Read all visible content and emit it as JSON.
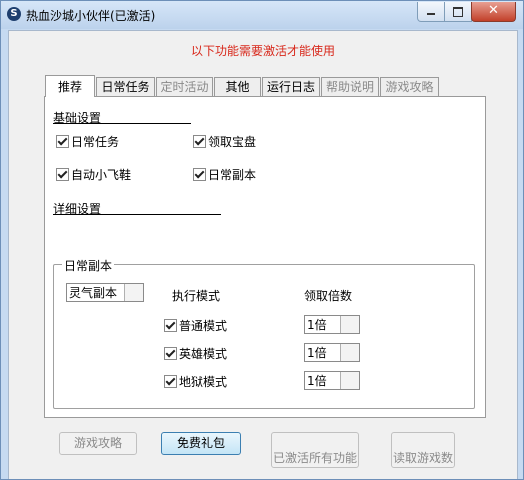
{
  "window": {
    "title": "热血沙城小伙伴(已激活)",
    "icon": "app-shield-icon",
    "controls": {
      "minimize": "minimize-icon",
      "maximize": "maximize-icon",
      "close": "close-icon"
    }
  },
  "notice": "以下功能需要激活才能使用",
  "tabs": [
    {
      "label": "推荐",
      "state": "active"
    },
    {
      "label": "日常任务",
      "state": "normal"
    },
    {
      "label": "定时活动",
      "state": "disabled"
    },
    {
      "label": "其他",
      "state": "normal"
    },
    {
      "label": "运行日志",
      "state": "normal"
    },
    {
      "label": "帮助说明",
      "state": "disabled"
    },
    {
      "label": "游戏攻略",
      "state": "disabled"
    }
  ],
  "basic": {
    "title": "基础设置",
    "options": [
      {
        "label": "日常任务",
        "checked": true
      },
      {
        "label": "领取宝盘",
        "checked": true
      },
      {
        "label": "自动小飞鞋",
        "checked": true
      },
      {
        "label": "日常副本",
        "checked": true
      }
    ]
  },
  "detail": {
    "title": "详细设置"
  },
  "dungeon": {
    "group_title": "日常副本",
    "dungeon_select": "灵气副本",
    "mode_header": "执行模式",
    "multiplier_header": "领取倍数",
    "modes": [
      {
        "label": "普通模式",
        "checked": true,
        "multiplier": "1倍"
      },
      {
        "label": "英雄模式",
        "checked": true,
        "multiplier": "1倍"
      },
      {
        "label": "地狱模式",
        "checked": true,
        "multiplier": "1倍"
      }
    ]
  },
  "buttons": {
    "game_guide": "游戏攻略",
    "free_gift": "免费礼包",
    "activate_all": "已激活所有功能",
    "read_game": "读取游戏数"
  }
}
